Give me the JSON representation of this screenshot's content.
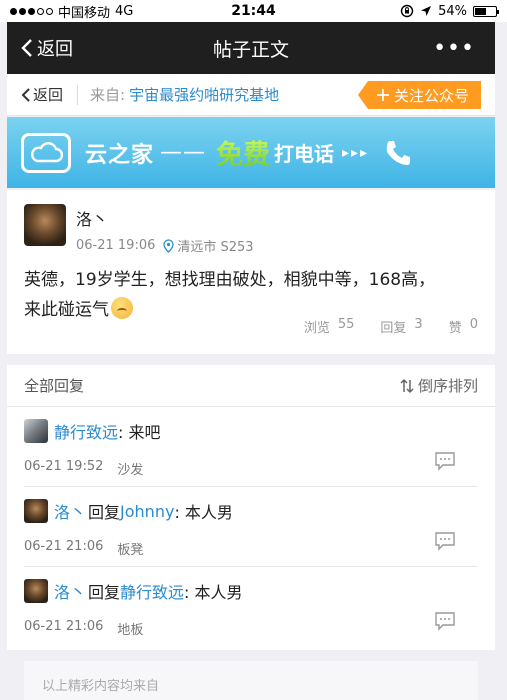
{
  "status": {
    "carrier": "中国移动",
    "network": "4G",
    "time": "21:44",
    "battery": "54%",
    "battery_level": 0.54
  },
  "nav": {
    "back": "返回",
    "title": "帖子正文",
    "more": "•••"
  },
  "source": {
    "back": "返回",
    "from": "来自:",
    "name": "宇宙最强约啪研究基地",
    "follow": "关注公众号"
  },
  "banner": {
    "brand": "云之家",
    "dash": "——",
    "free": "免费",
    "call": "打电话",
    "arrows": "▸▸▸"
  },
  "post": {
    "author": "洛丶",
    "time": "06-21 19:06",
    "location": "清远市 S253",
    "body_line1": "英德，19岁学生，想找理由破处，相貌中等，168高，",
    "body_line2": "来此碰运气",
    "stats": {
      "views_label": "浏览",
      "views": "55",
      "replies_label": "回复",
      "replies": "3",
      "likes_label": "赞",
      "likes": "0"
    }
  },
  "replies": {
    "header": "全部回复",
    "sort": "倒序排列",
    "items": [
      {
        "name": "静行致远",
        "reply_word": "",
        "target": "",
        "text": ": 来吧",
        "time": "06-21 19:52",
        "floor": "沙发"
      },
      {
        "name": "洛丶",
        "reply_word": "回复",
        "target": "Johnny",
        "text": ": 本人男",
        "time": "06-21 21:06",
        "floor": "板凳"
      },
      {
        "name": "洛丶",
        "reply_word": "回复",
        "target": "静行致远",
        "text": ": 本人男",
        "time": "06-21 21:06",
        "floor": "地板"
      }
    ]
  },
  "footer": {
    "text": "以上精彩内容均来自"
  },
  "colors": {
    "nav_bg": "#1f1f1f",
    "link": "#2a8bd0",
    "follow": "#ff9b20",
    "banner": "#3fb4e6"
  }
}
